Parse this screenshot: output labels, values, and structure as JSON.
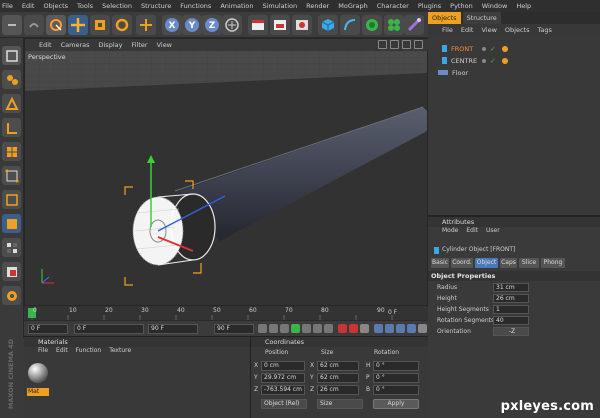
{
  "menubar": [
    "File",
    "Edit",
    "Objects",
    "Tools",
    "Selection",
    "Structure",
    "Functions",
    "Animation",
    "Simulation",
    "Render",
    "MoGraph",
    "Character",
    "Plugins",
    "Python",
    "Window",
    "Help"
  ],
  "viewport": {
    "menu": [
      "Edit",
      "Cameras",
      "Display",
      "Filter",
      "View"
    ],
    "label": "Perspective"
  },
  "timeline": {
    "ticks": [
      "0",
      "10",
      "20",
      "30",
      "40",
      "50",
      "60",
      "70",
      "80",
      "90"
    ],
    "end": "0 F",
    "start_field": "0 F",
    "current_field": "0 F",
    "min_field": "90 F",
    "max_field": "90 F"
  },
  "materials": {
    "title": "Materials",
    "menu": [
      "File",
      "Edit",
      "Function",
      "Texture"
    ],
    "item": "Mat"
  },
  "coordinates": {
    "title": "Coordinates",
    "headers": [
      "Position",
      "Size",
      "Rotation"
    ],
    "rows": [
      {
        "axis": "X",
        "pos": "0 cm",
        "saxis": "X",
        "size": "62 cm",
        "raxis": "H",
        "rot": "0 °"
      },
      {
        "axis": "Y",
        "pos": "29.972 cm",
        "saxis": "Y",
        "size": "62 cm",
        "raxis": "P",
        "rot": "0 °"
      },
      {
        "axis": "Z",
        "pos": "-763.594 cm",
        "saxis": "Z",
        "size": "26 cm",
        "raxis": "B",
        "rot": "0 °"
      }
    ],
    "mode": "Object (Rel)",
    "size_mode": "Size",
    "apply": "Apply"
  },
  "objects": {
    "tabs": [
      "Objects",
      "Structure"
    ],
    "menu": [
      "File",
      "Edit",
      "View",
      "Objects",
      "Tags"
    ],
    "items": [
      {
        "name": "FRONT",
        "color": "#ff8c3a"
      },
      {
        "name": "CENTRE",
        "color": "#d0d0d0"
      },
      {
        "name": "Floor",
        "color": "#d0d0d0"
      }
    ]
  },
  "attributes": {
    "title": "Attributes",
    "menu": [
      "Mode",
      "Edit",
      "User"
    ],
    "object": "Cylinder Object [FRONT]",
    "tabs": [
      "Basic",
      "Coord.",
      "Object",
      "Caps",
      "Slice",
      "Phong"
    ],
    "section": "Object Properties",
    "props": [
      {
        "label": "Radius",
        "value": "31 cm"
      },
      {
        "label": "Height",
        "value": "26 cm"
      },
      {
        "label": "Height Segments",
        "value": "1"
      },
      {
        "label": "Rotation Segments",
        "value": "40"
      },
      {
        "label": "Orientation",
        "value": "-Z"
      }
    ]
  },
  "brand": {
    "vertical": "MAXON CINEMA 4D"
  },
  "watermark": "pxleyes.com"
}
